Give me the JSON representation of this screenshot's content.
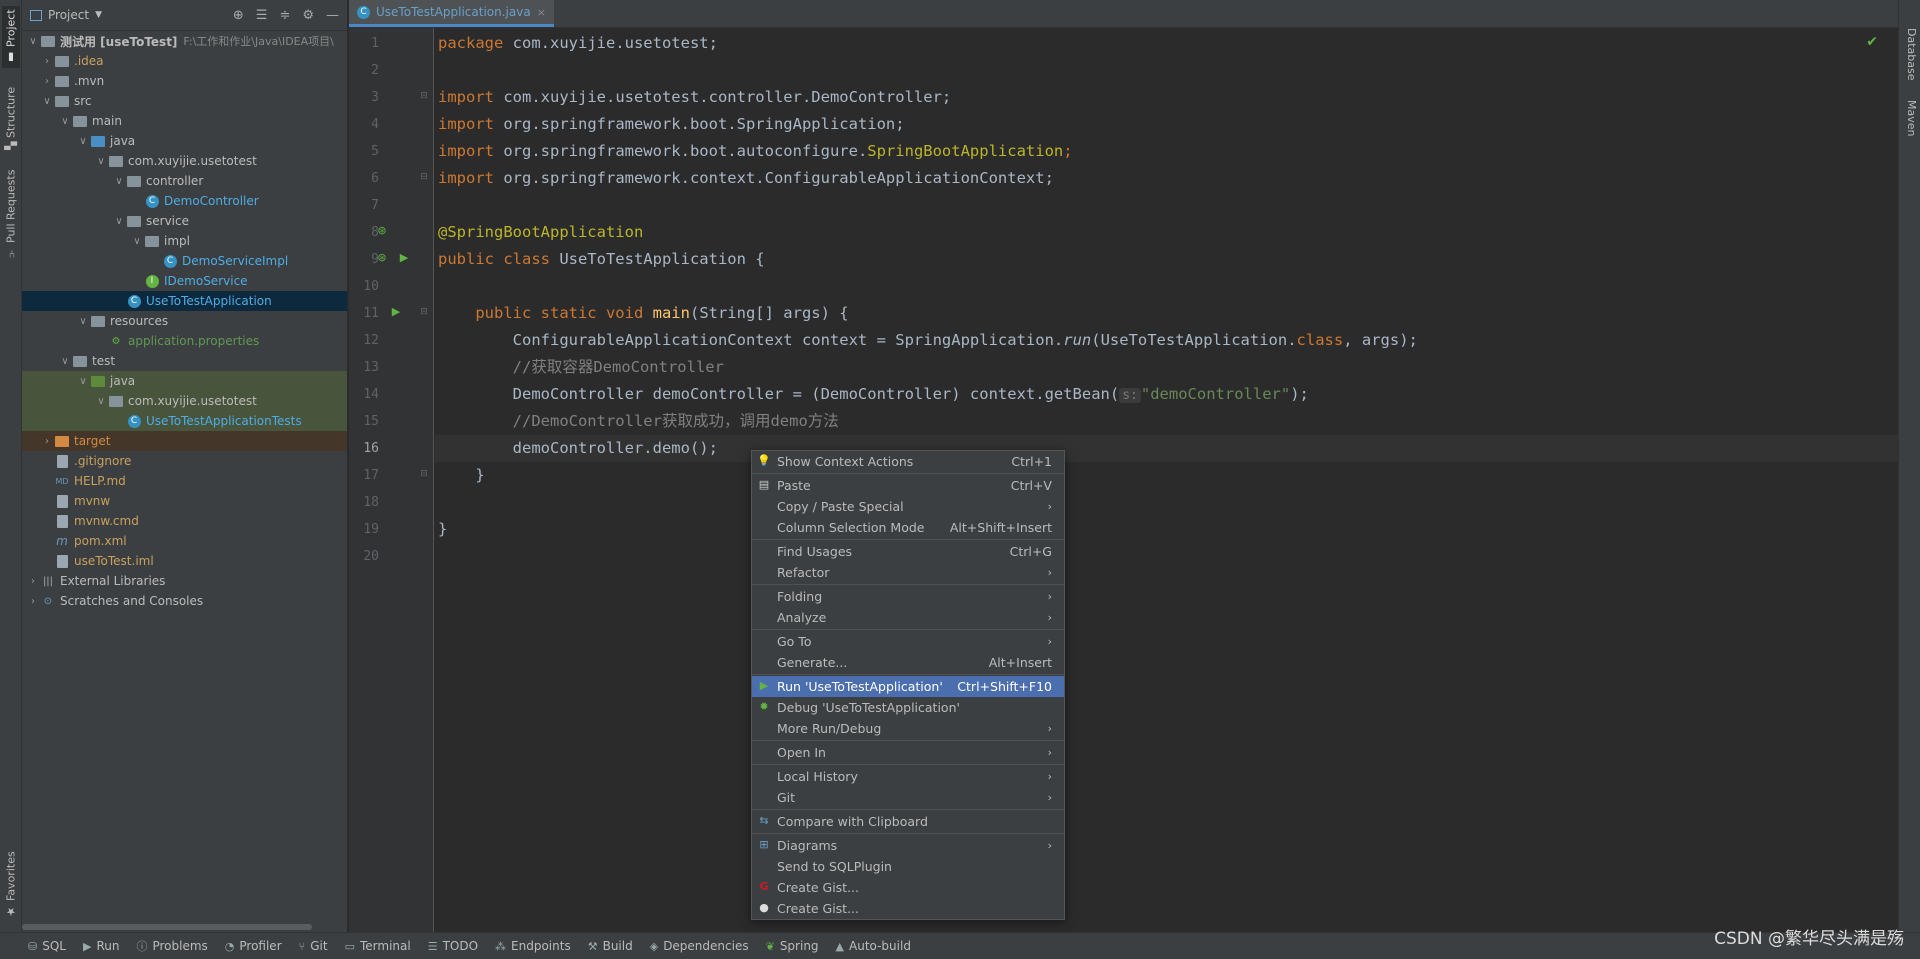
{
  "left_strip": {
    "project": "Project",
    "structure": "Structure",
    "pull_requests": "Pull Requests",
    "favorites": "Favorites"
  },
  "right_strip": {
    "database": "Database",
    "maven": "Maven"
  },
  "project_panel": {
    "title": "Project"
  },
  "tree": [
    {
      "label": "测试用 [useToTest]",
      "hint": "F:\\工作和作业\\Java\\IDEA项目\\"
    },
    {
      "label": ".idea"
    },
    {
      "label": ".mvn"
    },
    {
      "label": "src"
    },
    {
      "label": "main"
    },
    {
      "label": "java"
    },
    {
      "label": "com.xuyijie.usetotest"
    },
    {
      "label": "controller"
    },
    {
      "label": "DemoController"
    },
    {
      "label": "service"
    },
    {
      "label": "impl"
    },
    {
      "label": "DemoServiceImpl"
    },
    {
      "label": "IDemoService"
    },
    {
      "label": "UseToTestApplication"
    },
    {
      "label": "resources"
    },
    {
      "label": "application.properties"
    },
    {
      "label": "test"
    },
    {
      "label": "java"
    },
    {
      "label": "com.xuyijie.usetotest"
    },
    {
      "label": "UseToTestApplicationTests"
    },
    {
      "label": "target"
    },
    {
      "label": ".gitignore"
    },
    {
      "label": "HELP.md"
    },
    {
      "label": "mvnw"
    },
    {
      "label": "mvnw.cmd"
    },
    {
      "label": "pom.xml"
    },
    {
      "label": "useToTest.iml"
    },
    {
      "label": "External Libraries"
    },
    {
      "label": "Scratches and Consoles"
    }
  ],
  "editor": {
    "tab_label": "UseToTestApplication.java",
    "line_numbers": [
      "1",
      "2",
      "3",
      "4",
      "5",
      "6",
      "7",
      "8",
      "9",
      "10",
      "11",
      "12",
      "13",
      "14",
      "15",
      "16",
      "17",
      "18",
      "19",
      "20"
    ],
    "code": {
      "l1_kw": "package",
      "l1_rest": " com.xuyijie.usetotest;",
      "l3_kw": "import",
      "l3_rest": " com.xuyijie.usetotest.controller.DemoController;",
      "l4_kw": "import",
      "l4_rest": " org.springframework.boot.SpringApplication;",
      "l5_kw": "import",
      "l5_rest": " org.springframework.boot.autoconfigure.",
      "l5_ann": "SpringBootApplication",
      "l5_end": ";",
      "l6_kw": "import",
      "l6_rest": " org.springframework.context.ConfigurableApplicationContext;",
      "l8_ann": "@SpringBootApplication",
      "l9_kw": "public class",
      "l9_rest": " UseToTestApplication {",
      "l11_indent": "    ",
      "l11_kw": "public static void",
      "l11_fn": " main",
      "l11_rest": "(String[] args) {",
      "l12_a": "        ConfigurableApplicationContext context = SpringApplication.",
      "l12_it": "run",
      "l12_b": "(UseToTestApplication.",
      "l12_kw": "class",
      "l12_c": ", args);",
      "l13": "        //获取容器DemoController",
      "l14_a": "        DemoController demoController = (DemoController) context.getBean(",
      "l14_hint": "s:",
      "l14_str": "\"demoController\"",
      "l14_b": ");",
      "l15": "        //DemoController获取成功，调用demo方法",
      "l16": "        demoController.demo();",
      "l17": "    }",
      "l19": "}"
    }
  },
  "context_menu": [
    {
      "label": "Show Context Actions",
      "shortcut": "Ctrl+1"
    },
    {
      "label": "Paste",
      "shortcut": "Ctrl+V"
    },
    {
      "label": "Copy / Paste Special",
      "submenu": "›"
    },
    {
      "label": "Column Selection Mode",
      "shortcut": "Alt+Shift+Insert"
    },
    {
      "label": "Find Usages",
      "shortcut": "Ctrl+G"
    },
    {
      "label": "Refactor",
      "submenu": "›"
    },
    {
      "label": "Folding",
      "submenu": "›"
    },
    {
      "label": "Analyze",
      "submenu": "›"
    },
    {
      "label": "Go To",
      "submenu": "›"
    },
    {
      "label": "Generate...",
      "shortcut": "Alt+Insert"
    },
    {
      "label": "Run 'UseToTestApplication'",
      "shortcut": "Ctrl+Shift+F10"
    },
    {
      "label": "Debug 'UseToTestApplication'"
    },
    {
      "label": "More Run/Debug",
      "submenu": "›"
    },
    {
      "label": "Open In",
      "submenu": "›"
    },
    {
      "label": "Local History",
      "submenu": "›"
    },
    {
      "label": "Git",
      "submenu": "›"
    },
    {
      "label": "Compare with Clipboard"
    },
    {
      "label": "Diagrams",
      "submenu": "›"
    },
    {
      "label": "Send to SQLPlugin"
    },
    {
      "label": "Create Gist..."
    },
    {
      "label": "Create Gist..."
    }
  ],
  "status_bar": [
    "SQL",
    "Run",
    "Problems",
    "Profiler",
    "Git",
    "Terminal",
    "TODO",
    "Endpoints",
    "Build",
    "Dependencies",
    "Spring",
    "Auto-build"
  ],
  "watermark": "CSDN @繁华尽头满是殇",
  "colors": {
    "selection": "#4b6eaf",
    "keyword": "#cc7832",
    "annotation": "#bbb529",
    "string": "#6a8759",
    "comment": "#808080"
  }
}
